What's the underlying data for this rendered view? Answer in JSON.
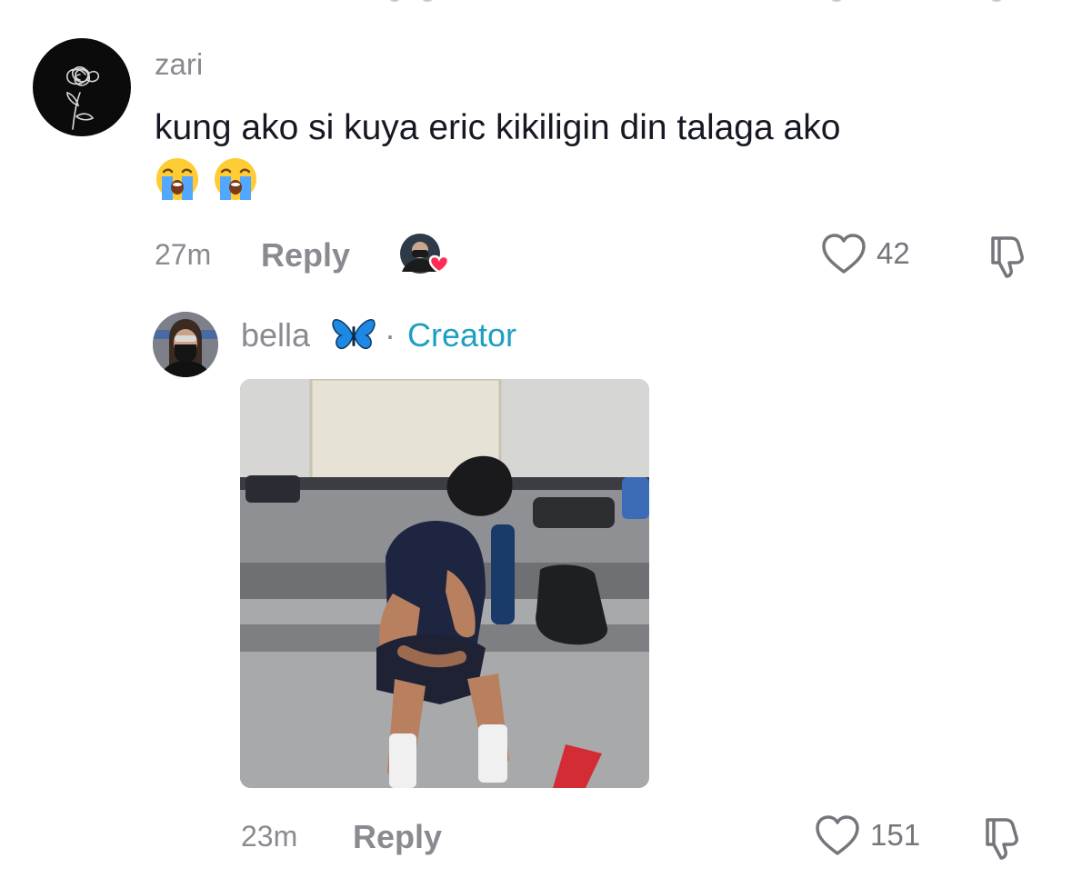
{
  "comments": [
    {
      "username": "zari",
      "text": "kung ako si kuya eric kikiligin din talaga ako",
      "emojis": [
        "loudly-crying-face",
        "loudly-crying-face"
      ],
      "time": "27m",
      "reply_label": "Reply",
      "likes": "42",
      "liked_by_creator": true
    },
    {
      "username": "bella",
      "badge_emoji": "butterfly",
      "separator": "·",
      "creator_label": "Creator",
      "media": "photo of a player sitting on a bench with head in hand",
      "time": "23m",
      "reply_label": "Reply",
      "likes": "151"
    }
  ],
  "colors": {
    "text_primary": "#161823",
    "text_secondary": "#8a8b91",
    "creator_accent": "#1e9fc2",
    "heart_red": "#fe2c55"
  },
  "icons": [
    "heart-outline-icon",
    "dislike-icon",
    "creator-liked-heart-icon"
  ]
}
